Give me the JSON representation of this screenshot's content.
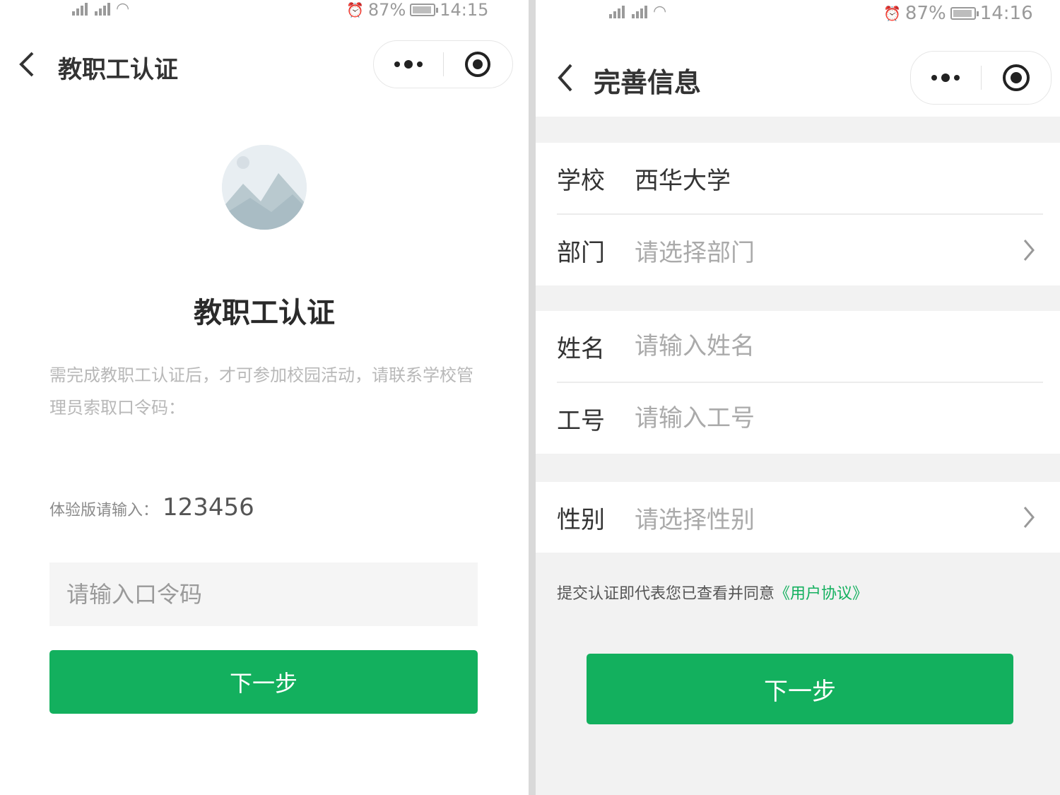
{
  "left": {
    "status": {
      "time": "14:15",
      "battery": "87%"
    },
    "nav": {
      "title": "教职工认证"
    },
    "heading": "教职工认证",
    "description": "需完成教职工认证后，才可参加校园活动，请联系学校管理员索取口令码：",
    "trial_label": "体验版请输入：",
    "trial_code": "123456",
    "code_placeholder": "请输入口令码",
    "next_label": "下一步"
  },
  "right": {
    "status": {
      "time": "14:16",
      "battery": "87%"
    },
    "nav": {
      "title": "完善信息"
    },
    "school": {
      "label": "学校",
      "value": "西华大学"
    },
    "department": {
      "label": "部门",
      "placeholder": "请选择部门"
    },
    "name": {
      "label": "姓名",
      "placeholder": "请输入姓名"
    },
    "staff_id": {
      "label": "工号",
      "placeholder": "请输入工号"
    },
    "gender": {
      "label": "性别",
      "placeholder": "请选择性别"
    },
    "agreement_text": "提交认证即代表您已查看并同意",
    "agreement_link": "《用户协议》",
    "next_label": "下一步"
  },
  "colors": {
    "primary": "#13b05e",
    "bg": "#f2f2f2"
  }
}
